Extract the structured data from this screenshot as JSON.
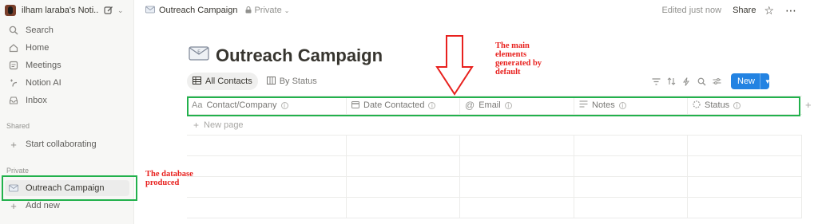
{
  "workspace": {
    "name": "ilham laraba's Noti..."
  },
  "sidebar": {
    "items": [
      {
        "label": "Search",
        "icon": "search-icon"
      },
      {
        "label": "Home",
        "icon": "home-icon"
      },
      {
        "label": "Meetings",
        "icon": "meetings-icon"
      },
      {
        "label": "Notion AI",
        "icon": "ai-icon"
      },
      {
        "label": "Inbox",
        "icon": "inbox-icon"
      }
    ],
    "shared_label": "Shared",
    "start_collaborating": "Start collaborating",
    "private_label": "Private",
    "page_item": "Outreach Campaign",
    "add_new": "Add new"
  },
  "topbar": {
    "breadcrumb": "Outreach Campaign",
    "privacy": "Private",
    "edited": "Edited just now",
    "share": "Share"
  },
  "page": {
    "title": "Outreach Campaign",
    "icon": "envelope-icon"
  },
  "views": [
    {
      "label": "All Contacts",
      "icon": "table-icon"
    },
    {
      "label": "By Status",
      "icon": "board-icon"
    }
  ],
  "toolbar": {
    "new_label": "New"
  },
  "table": {
    "columns": [
      {
        "label": "Contact/Company",
        "icon": "text-icon"
      },
      {
        "label": "Date Contacted",
        "icon": "calendar-icon"
      },
      {
        "label": "Email",
        "icon": "at-icon"
      },
      {
        "label": "Notes",
        "icon": "lines-icon"
      },
      {
        "label": "Status",
        "icon": "status-icon"
      }
    ],
    "new_page": "New page"
  },
  "annotations": {
    "main_elements": "The main elements generated by default",
    "database": "The database produced"
  },
  "colors": {
    "accent": "#2383e2",
    "annotation_box": "#22b14c",
    "annotation_text": "#e8211e"
  }
}
